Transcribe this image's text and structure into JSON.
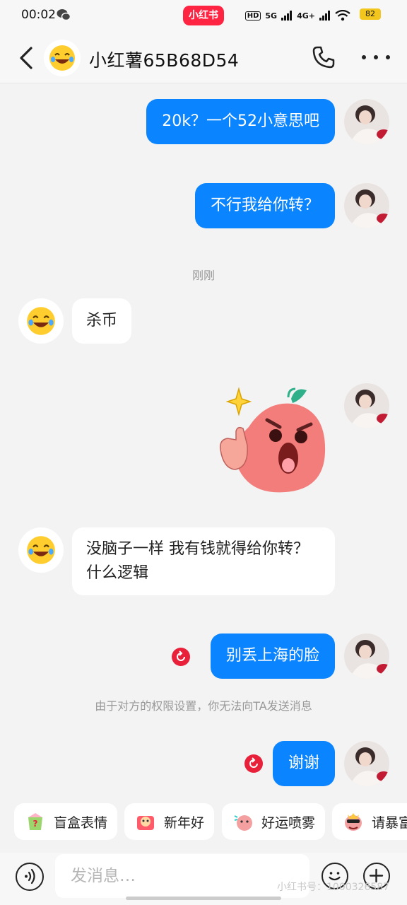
{
  "status_bar": {
    "time": "00:02",
    "app_badge": "小红书",
    "network_1": "HD",
    "network_2": "5G",
    "network_3": "4G+",
    "battery": "82"
  },
  "header": {
    "contact_name": "小红薯65B68D54",
    "back_icon": "chevron-left-icon",
    "call_icon": "phone-icon",
    "more_icon": "more-dots-icon"
  },
  "messages": [
    {
      "from": "me",
      "text": "20k？一个52小意思吧"
    },
    {
      "from": "me",
      "text": "不行我给你转？"
    },
    {
      "from": "other",
      "text": "杀币"
    },
    {
      "from": "me",
      "sticker": "angry-peach-sticker"
    },
    {
      "from": "other",
      "text": "没脑子一样 我有钱就得给你转？ 什么逻辑"
    },
    {
      "from": "me",
      "text": "别丢上海的脸",
      "failed": true
    },
    {
      "from": "me",
      "text": "谢谢",
      "failed": true
    }
  ],
  "time_divider": "刚刚",
  "system_notice": "由于对方的权限设置，你无法向TA发送消息",
  "sticker_tray": [
    {
      "label": "盲盒表情",
      "icon": "mystery-box-icon"
    },
    {
      "label": "新年好",
      "icon": "new-year-icon"
    },
    {
      "label": "好运喷雾",
      "icon": "luck-spray-icon"
    },
    {
      "label": "请暴富",
      "icon": "get-rich-icon"
    }
  ],
  "input": {
    "placeholder": "发消息…",
    "voice_icon": "voice-icon",
    "emoji_icon": "emoji-icon",
    "plus_icon": "plus-icon"
  },
  "watermark": "小红书号：1000326587",
  "colors": {
    "my_bubble": "#0a84ff",
    "brand": "#ff2442",
    "failed_badge": "#e8203a"
  }
}
